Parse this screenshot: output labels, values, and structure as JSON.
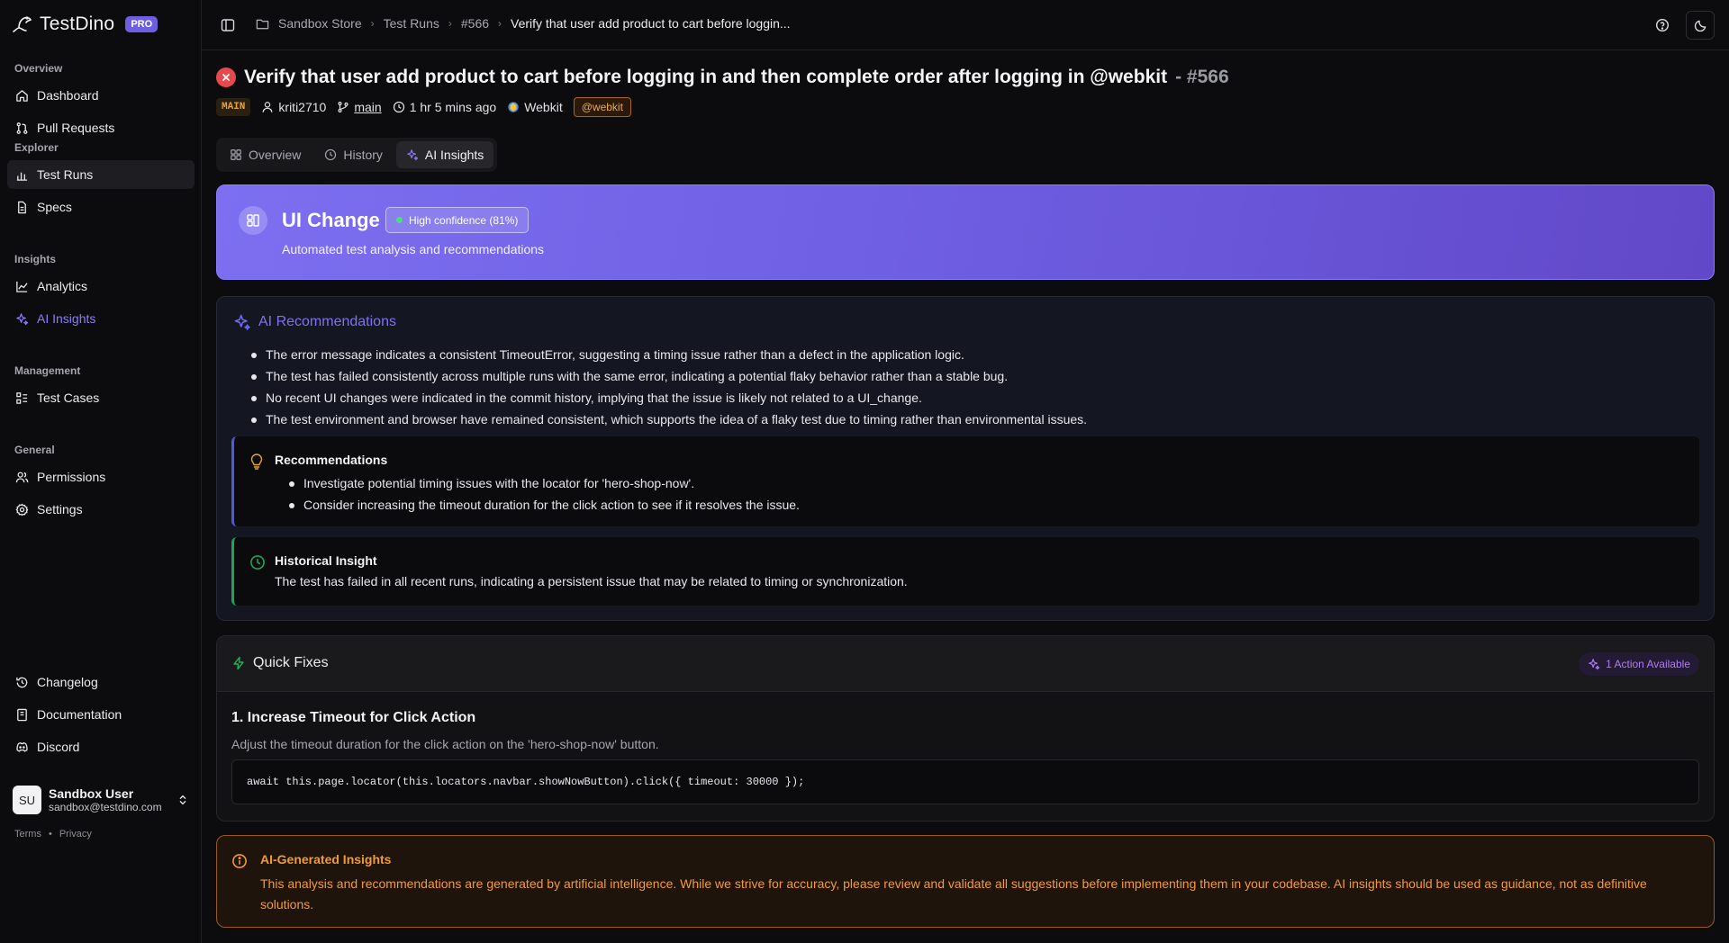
{
  "app": {
    "name": "TestDino",
    "plan_badge": "PRO"
  },
  "sidebar": {
    "groups": [
      {
        "title": "Overview",
        "items": [
          {
            "label": "Dashboard",
            "icon": "home-icon"
          },
          {
            "label": "Pull Requests",
            "icon": "git-pull-request-icon"
          }
        ]
      },
      {
        "title": "Explorer",
        "items": [
          {
            "label": "Test Runs",
            "icon": "bar-chart-icon",
            "active": true
          },
          {
            "label": "Specs",
            "icon": "file-text-icon"
          }
        ]
      },
      {
        "title": "Insights",
        "items": [
          {
            "label": "Analytics",
            "icon": "line-chart-icon"
          },
          {
            "label": "AI Insights",
            "icon": "sparkles-icon",
            "accent": true
          }
        ]
      },
      {
        "title": "Management",
        "items": [
          {
            "label": "Test Cases",
            "icon": "list-checks-icon"
          }
        ]
      },
      {
        "title": "General",
        "items": [
          {
            "label": "Permissions",
            "icon": "users-icon"
          },
          {
            "label": "Settings",
            "icon": "gear-icon"
          }
        ]
      }
    ],
    "footer_items": [
      {
        "label": "Changelog",
        "icon": "history-icon"
      },
      {
        "label": "Documentation",
        "icon": "book-icon"
      },
      {
        "label": "Discord",
        "icon": "discord-icon"
      }
    ],
    "user": {
      "initials": "SU",
      "name": "Sandbox User",
      "email": "sandbox@testdino.com"
    },
    "legal": {
      "terms": "Terms",
      "separator": "•",
      "privacy": "Privacy"
    }
  },
  "topbar": {
    "breadcrumb": [
      "Sandbox Store",
      "Test Runs",
      "#566",
      "Verify that user add product to cart before loggin..."
    ]
  },
  "test": {
    "title": "Verify that user add product to cart before logging in and then complete order after logging in @webkit",
    "run_number": "- #566",
    "branch_badge": "MAIN",
    "author": "kriti2710",
    "branch": "main",
    "time_ago": "1 hr 5 mins ago",
    "browser": "Webkit",
    "tag": "@webkit"
  },
  "tabs": [
    {
      "label": "Overview",
      "icon": "grid-icon"
    },
    {
      "label": "History",
      "icon": "clock-icon"
    },
    {
      "label": "AI Insights",
      "icon": "sparkles-icon",
      "active": true
    }
  ],
  "hero": {
    "title": "UI Change",
    "confidence": "High confidence (81%)",
    "subtitle": "Automated test analysis and recommendations"
  },
  "ai_recommendations": {
    "title": "AI Recommendations",
    "bullets": [
      "The error message indicates a consistent TimeoutError, suggesting a timing issue rather than a defect in the application logic.",
      "The test has failed consistently across multiple runs with the same error, indicating a potential flaky behavior rather than a stable bug.",
      "No recent UI changes were indicated in the commit history, implying that the issue is likely not related to a UI_change.",
      "The test environment and browser have remained consistent, which supports the idea of a flaky test due to timing rather than environmental issues."
    ],
    "recommendations": {
      "title": "Recommendations",
      "items": [
        "Investigate potential timing issues with the locator for 'hero-shop-now'.",
        "Consider increasing the timeout duration for the click action to see if it resolves the issue."
      ]
    },
    "historical": {
      "title": "Historical Insight",
      "text": "The test has failed in all recent runs, indicating a persistent issue that may be related to timing or synchronization."
    }
  },
  "quick_fixes": {
    "title": "Quick Fixes",
    "action_badge": "1 Action Available",
    "fix": {
      "title": "1. Increase Timeout for Click Action",
      "description": "Adjust the timeout duration for the click action on the 'hero-shop-now' button.",
      "code": "await this.page.locator(this.locators.navbar.showNowButton).click({ timeout: 30000 });"
    }
  },
  "disclaimer": {
    "title": "AI-Generated Insights",
    "text": "This analysis and recommendations are generated by artificial intelligence. While we strive for accuracy, please review and validate all suggestions before implementing them in your codebase. AI insights should be used as guidance, not as definitive solutions."
  },
  "colors": {
    "accent": "#7d6ff0",
    "fail": "#e5484d",
    "warning": "#f29a3a",
    "success": "#22a352"
  }
}
